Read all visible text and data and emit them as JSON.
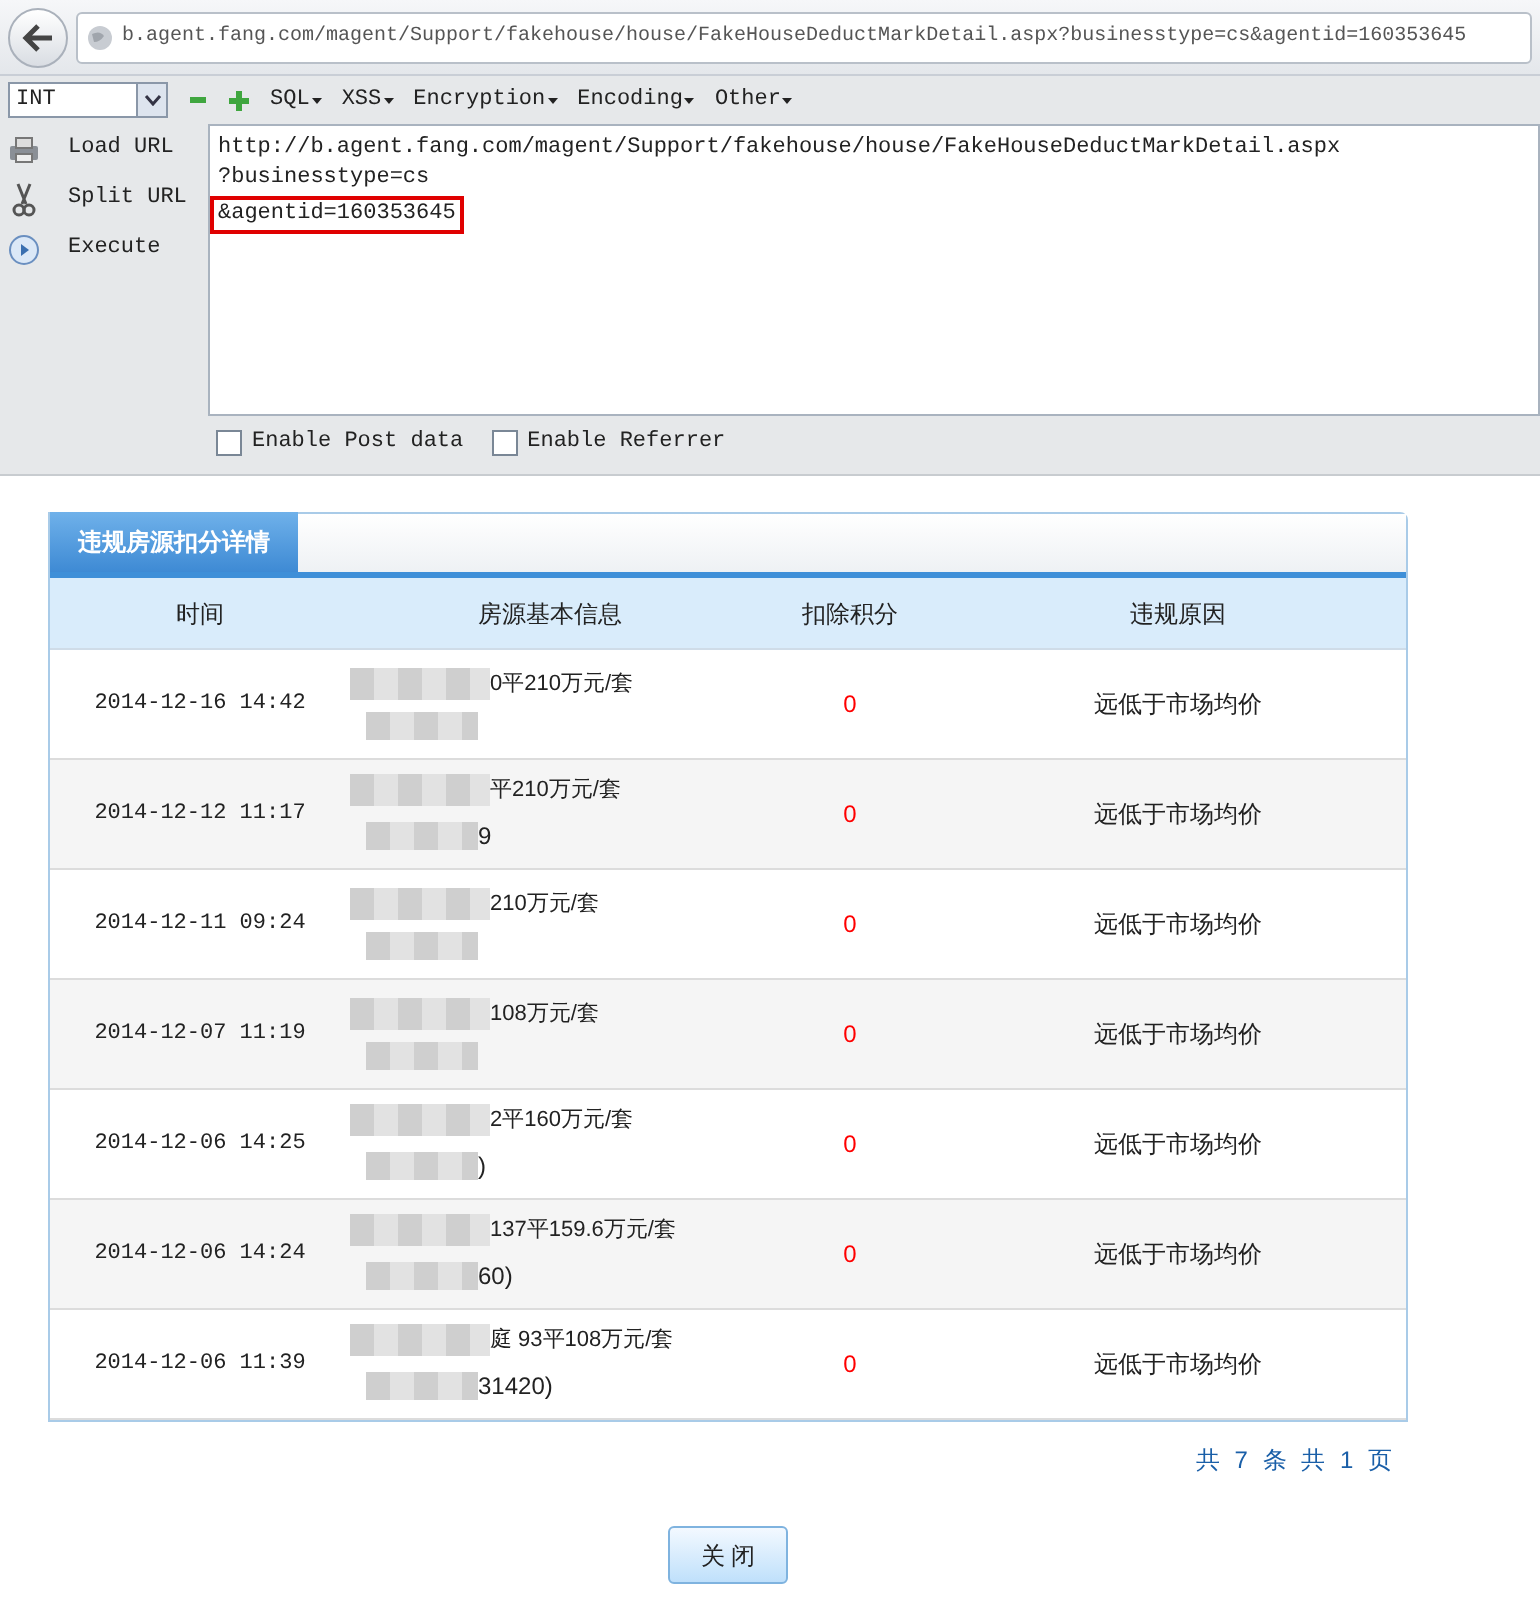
{
  "address_bar": {
    "url": "b.agent.fang.com/magent/Support/fakehouse/house/FakeHouseDeductMarkDetail.aspx?businesstype=cs&agentid=160353645"
  },
  "hackbar": {
    "type_select": "INT",
    "menus": [
      "SQL",
      "XSS",
      "Encryption",
      "Encoding",
      "Other"
    ],
    "actions": [
      {
        "kind": "load",
        "label": "Load URL"
      },
      {
        "kind": "split",
        "label": "Split URL"
      },
      {
        "kind": "execute",
        "label": "Execute"
      }
    ],
    "url_lines": [
      "http://b.agent.fang.com/magent/Support/fakehouse/house/FakeHouseDeductMarkDetail.aspx",
      "?businesstype=cs",
      "&agentid=160353645"
    ],
    "options": [
      {
        "label": "Enable Post data",
        "checked": false
      },
      {
        "label": "Enable Referrer",
        "checked": false
      }
    ]
  },
  "panel": {
    "tab": "违规房源扣分详情",
    "columns": [
      "时间",
      "房源基本信息",
      "扣除积分",
      "违规原因"
    ],
    "rows": [
      {
        "time": "2014-12-16 14:42",
        "info_line1": "0平210万元/套",
        "points": "0",
        "reason": "远低于市场均价"
      },
      {
        "time": "2014-12-12 11:17",
        "info_line1": "平210万元/套",
        "info_line2": "9",
        "points": "0",
        "reason": "远低于市场均价"
      },
      {
        "time": "2014-12-11 09:24",
        "info_line1": "210万元/套",
        "points": "0",
        "reason": "远低于市场均价"
      },
      {
        "time": "2014-12-07 11:19",
        "info_line1": "108万元/套",
        "points": "0",
        "reason": "远低于市场均价"
      },
      {
        "time": "2014-12-06 14:25",
        "info_line1": "2平160万元/套",
        "info_line2": ")",
        "points": "0",
        "reason": "远低于市场均价"
      },
      {
        "time": "2014-12-06 14:24",
        "info_line1": "137平159.6万元/套",
        "info_line2": "60)",
        "points": "0",
        "reason": "远低于市场均价"
      },
      {
        "time": "2014-12-06 11:39",
        "info_line1": "庭 93平108万元/套",
        "info_line2": "31420)",
        "points": "0",
        "reason": "远低于市场均价"
      }
    ],
    "pagination": "共 7 条 共 1 页",
    "close_button": "关 闭"
  }
}
